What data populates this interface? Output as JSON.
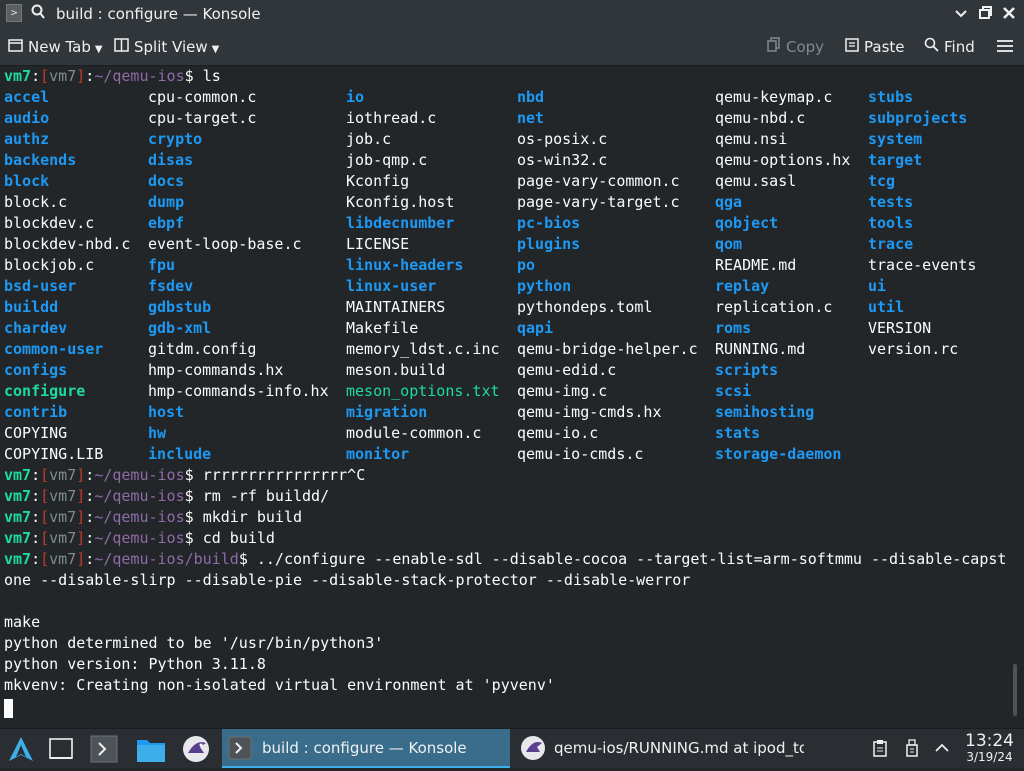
{
  "window": {
    "title": "build : configure — Konsole",
    "app_icon": ">",
    "icons": [
      "konsole-app-icon",
      "pin-icon",
      "minimize-icon",
      "maximize-icon",
      "close-icon"
    ]
  },
  "toolbar": {
    "new_tab": "New Tab",
    "split_view": "Split View",
    "copy": "Copy",
    "paste": "Paste",
    "find": "Find"
  },
  "prompt": {
    "host": "vm7",
    "name": "vm7"
  },
  "commands": {
    "c1": {
      "path": "~/qemu-ios",
      "cmd": "ls"
    },
    "c2": {
      "path": "~/qemu-ios",
      "cmd": "rrrrrrrrrrrrrrrr^C"
    },
    "c3": {
      "path": "~/qemu-ios",
      "cmd": "rm -rf buildd/"
    },
    "c4": {
      "path": "~/qemu-ios",
      "cmd": "mkdir build"
    },
    "c5": {
      "path": "~/qemu-ios",
      "cmd": "cd build"
    },
    "c6": {
      "path": "~/qemu-ios/build",
      "cmd": "../configure --enable-sdl --disable-cocoa --target-list=arm-softmmu --disable-capst"
    }
  },
  "ls_columns": [
    [
      [
        "accel",
        "dir"
      ],
      [
        "audio",
        "dir"
      ],
      [
        "authz",
        "dir"
      ],
      [
        "backends",
        "dir"
      ],
      [
        "block",
        "dir"
      ],
      [
        "block.c",
        "file"
      ],
      [
        "blockdev.c",
        "file"
      ],
      [
        "blockdev-nbd.c",
        "file"
      ],
      [
        "blockjob.c",
        "file"
      ],
      [
        "bsd-user",
        "dir"
      ],
      [
        "buildd",
        "dir"
      ],
      [
        "chardev",
        "dir"
      ],
      [
        "common-user",
        "dir"
      ],
      [
        "configs",
        "dir"
      ],
      [
        "configure",
        "exe"
      ],
      [
        "contrib",
        "dir"
      ],
      [
        "COPYING",
        "file"
      ],
      [
        "COPYING.LIB",
        "file"
      ]
    ],
    [
      [
        "cpu-common.c",
        "file"
      ],
      [
        "cpu-target.c",
        "file"
      ],
      [
        "crypto",
        "dir"
      ],
      [
        "disas",
        "dir"
      ],
      [
        "docs",
        "dir"
      ],
      [
        "dump",
        "dir"
      ],
      [
        "ebpf",
        "dir"
      ],
      [
        "event-loop-base.c",
        "file"
      ],
      [
        "fpu",
        "dir"
      ],
      [
        "fsdev",
        "dir"
      ],
      [
        "gdbstub",
        "dir"
      ],
      [
        "gdb-xml",
        "dir"
      ],
      [
        "gitdm.config",
        "file"
      ],
      [
        "hmp-commands.hx",
        "file"
      ],
      [
        "hmp-commands-info.hx",
        "file"
      ],
      [
        "host",
        "dir"
      ],
      [
        "hw",
        "dir"
      ],
      [
        "include",
        "dir"
      ]
    ],
    [
      [
        "io",
        "dir"
      ],
      [
        "iothread.c",
        "file"
      ],
      [
        "job.c",
        "file"
      ],
      [
        "job-qmp.c",
        "file"
      ],
      [
        "Kconfig",
        "file"
      ],
      [
        "Kconfig.host",
        "file"
      ],
      [
        "libdecnumber",
        "dir"
      ],
      [
        "LICENSE",
        "file"
      ],
      [
        "linux-headers",
        "dir"
      ],
      [
        "linux-user",
        "dir"
      ],
      [
        "MAINTAINERS",
        "file"
      ],
      [
        "Makefile",
        "file"
      ],
      [
        "memory_ldst.c.inc",
        "file"
      ],
      [
        "meson.build",
        "file"
      ],
      [
        "meson_options.txt",
        "green"
      ],
      [
        "migration",
        "dir"
      ],
      [
        "module-common.c",
        "file"
      ],
      [
        "monitor",
        "dir"
      ]
    ],
    [
      [
        "nbd",
        "dir"
      ],
      [
        "net",
        "dir"
      ],
      [
        "os-posix.c",
        "file"
      ],
      [
        "os-win32.c",
        "file"
      ],
      [
        "page-vary-common.c",
        "file"
      ],
      [
        "page-vary-target.c",
        "file"
      ],
      [
        "pc-bios",
        "dir"
      ],
      [
        "plugins",
        "dir"
      ],
      [
        "po",
        "dir"
      ],
      [
        "python",
        "dir"
      ],
      [
        "pythondeps.toml",
        "file"
      ],
      [
        "qapi",
        "dir"
      ],
      [
        "qemu-bridge-helper.c",
        "file"
      ],
      [
        "qemu-edid.c",
        "file"
      ],
      [
        "qemu-img.c",
        "file"
      ],
      [
        "qemu-img-cmds.hx",
        "file"
      ],
      [
        "qemu-io.c",
        "file"
      ],
      [
        "qemu-io-cmds.c",
        "file"
      ]
    ],
    [
      [
        "qemu-keymap.c",
        "file"
      ],
      [
        "qemu-nbd.c",
        "file"
      ],
      [
        "qemu.nsi",
        "file"
      ],
      [
        "qemu-options.hx",
        "file"
      ],
      [
        "qemu.sasl",
        "file"
      ],
      [
        "qga",
        "dir"
      ],
      [
        "qobject",
        "dir"
      ],
      [
        "qom",
        "dir"
      ],
      [
        "README.md",
        "file"
      ],
      [
        "replay",
        "dir"
      ],
      [
        "replication.c",
        "file"
      ],
      [
        "roms",
        "dir"
      ],
      [
        "RUNNING.md",
        "file"
      ],
      [
        "scripts",
        "dir"
      ],
      [
        "scsi",
        "dir"
      ],
      [
        "semihosting",
        "dir"
      ],
      [
        "stats",
        "dir"
      ],
      [
        "storage-daemon",
        "dir"
      ]
    ],
    [
      [
        "stubs",
        "dir"
      ],
      [
        "subprojects",
        "dir"
      ],
      [
        "system",
        "dir"
      ],
      [
        "target",
        "dir"
      ],
      [
        "tcg",
        "dir"
      ],
      [
        "tests",
        "dir"
      ],
      [
        "tools",
        "dir"
      ],
      [
        "trace",
        "dir"
      ],
      [
        "trace-events",
        "file"
      ],
      [
        "ui",
        "dir"
      ],
      [
        "util",
        "dir"
      ],
      [
        "VERSION",
        "file"
      ],
      [
        "version.rc",
        "file"
      ]
    ]
  ],
  "output": {
    "wrap": "one --disable-slirp --disable-pie --disable-stack-protector --disable-werror",
    "blank": "",
    "make": "make",
    "o1": "python determined to be '/usr/bin/python3'",
    "o2": "python version: Python 3.11.8",
    "o3": "mkvenv: Creating non-isolated virtual environment at 'pyvenv'"
  },
  "taskbar": {
    "launcher_icons": [
      "app-launcher-icon",
      "show-desktop-icon",
      "terminal-icon",
      "file-manager-icon",
      "kate-icon"
    ],
    "tasks": [
      {
        "label": "build : configure — Konsole",
        "active": true
      },
      {
        "label": "qemu-ios/RUNNING.md at ipod_to...",
        "active": false
      }
    ],
    "tray_icons": [
      "clipboard-icon",
      "usb-icon",
      "expand-tray-icon"
    ],
    "time": "13:24",
    "date": "3/19/24"
  },
  "colors": {
    "dir": "#1d99f3",
    "exe": "#1cdc9a",
    "text": "#fcfcfc",
    "bg": "#232629",
    "prompt_path": "#8e6ba8",
    "prompt_bracket": "#c0392b"
  }
}
